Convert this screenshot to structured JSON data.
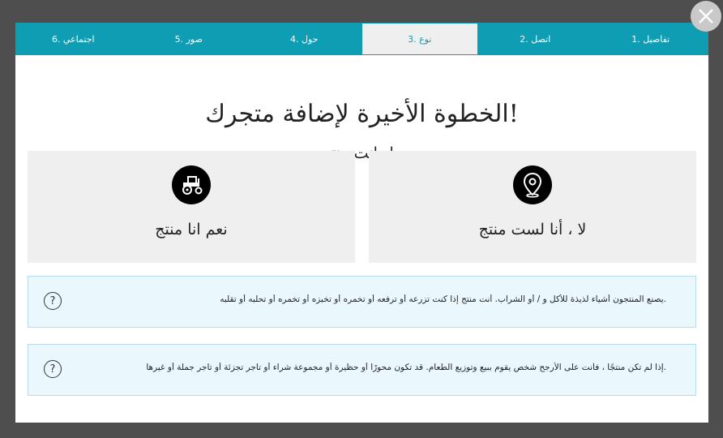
{
  "tabs": [
    {
      "label": "تفاصيل .1",
      "active": false
    },
    {
      "label": "اتصل .2",
      "active": false
    },
    {
      "label": "نوع .3",
      "active": true
    },
    {
      "label": "حول .4",
      "active": false
    },
    {
      "label": "صور .5",
      "active": false
    },
    {
      "label": "اجتماعي .6",
      "active": false
    }
  ],
  "close_icon": "close-icon",
  "title": "!الخطوة الأخيرة لإضافة متجرك",
  "subtitle": "هل انت منتج",
  "choices": {
    "producer": {
      "label": "نعم انا منتج",
      "icon": "tractor-icon"
    },
    "not_producer": {
      "label": "لا ، أنا لست منتج",
      "icon": "location-pin-icon"
    }
  },
  "info": [
    {
      "text": ".يصنع المنتجون أشياء لذيذة للأكل و / أو الشراب. أنت منتج إذا كنت تزرعه أو ترفعه أو تخمره أو تخبزه أو تخمره أو تحلبه أو تقلبه",
      "icon": "question-icon",
      "icon_glyph": "?"
    },
    {
      "text": ".إذا لم تكن منتجًا ، فأنت على الأرجح شخص يقوم ببيع وتوزيع الطعام. قد تكون محورًا أو حظيرة أو مجموعة شراء أو تاجر تجزئة أو تاجر جملة أو غيرها",
      "icon": "question-icon",
      "icon_glyph": "?"
    }
  ],
  "colors": {
    "accent": "#0f9db3",
    "overlay": "#4e4e4e",
    "card": "#efefef",
    "info_bg": "#eaf7fd"
  }
}
